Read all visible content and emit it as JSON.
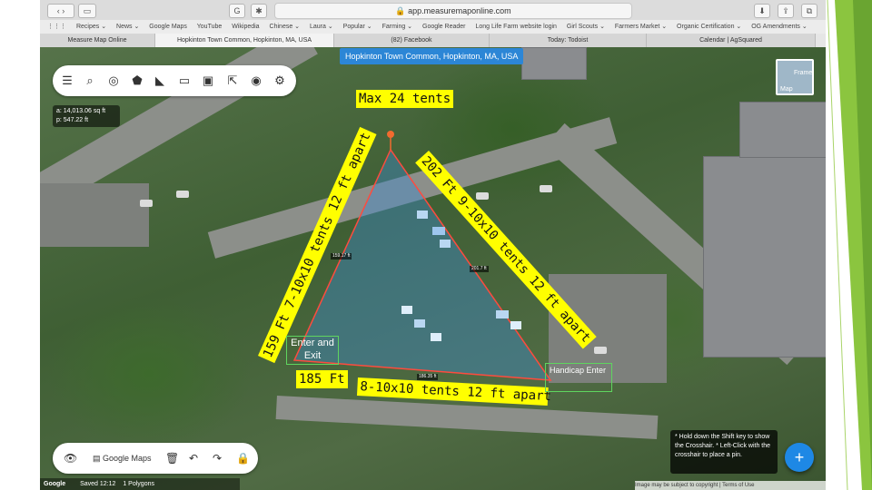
{
  "browser": {
    "url": "app.measuremaponline.com",
    "bookmarks": [
      "Recipes ⌄",
      "News ⌄",
      "Google Maps",
      "YouTube",
      "Wikipedia",
      "Chinese ⌄",
      "Laura ⌄",
      "Popular ⌄",
      "Farming ⌄",
      "Google Reader",
      "Long Life Farm website login",
      "Girl Scouts ⌄",
      "Farmers Market ⌄",
      "Organic Certification ⌄",
      "OG Amendments ⌄"
    ],
    "tabs": [
      "Measure Map Online",
      "Hopkinton Town Common, Hopkinton, MA, USA",
      "(82) Facebook",
      "Today: Todoist",
      "Calendar | AgSquared"
    ]
  },
  "map": {
    "title": "Hopkinton Town Common, Hopkinton, MA, USA",
    "area": "a: 14,013.06 sq ft",
    "perimeter": "p: 547.22 ft",
    "map_type": "Map",
    "frame_label": "Frame",
    "edge_labels": [
      "159.17 ft",
      "201.7 ft",
      "186.35 ft"
    ],
    "bottom": {
      "google_maps": "Google Maps"
    },
    "status": {
      "saved": "Saved 12:12",
      "polygons": "1 Polygons"
    },
    "hint": "* Hold down the Shift key to show the Crosshair. * Left-Click with the crosshair to place a pin.",
    "fab": "+",
    "footer": "Image may be subject to copyright | Terms of Use",
    "google_logo": "Google"
  },
  "annotations": {
    "max": "Max 24 tents",
    "left_side": "159 Ft   7-10x10 tents 12 ft apart",
    "right_side": "202 Ft   9-10x10 tents 12 ft apart",
    "bottom_ft": "185 Ft",
    "bottom_tents": "8-10x10 tents 12 ft apart",
    "enter_exit": "Enter and Exit",
    "handicap": "Handicap Enter"
  }
}
